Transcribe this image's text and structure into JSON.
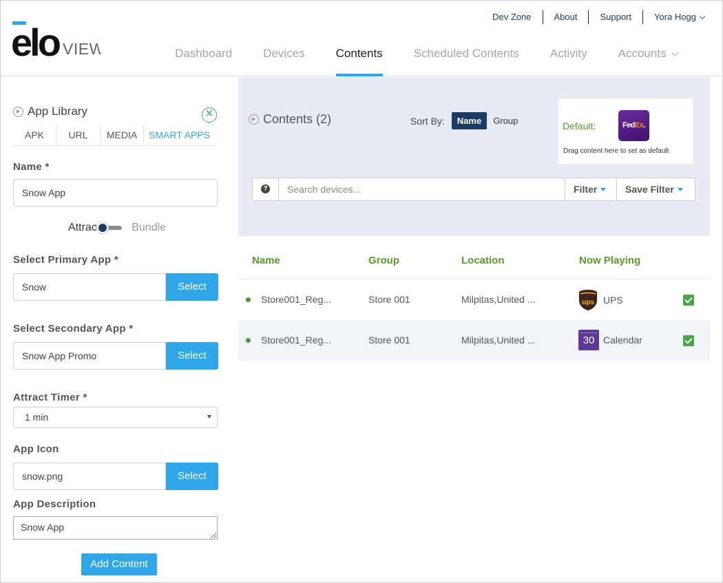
{
  "header": {
    "logo_text": "elo VIEW",
    "top_links": [
      "Dev Zone",
      "About",
      "Support",
      "Yora Hogg"
    ],
    "tabs": [
      {
        "label": "Dashboard",
        "active": false
      },
      {
        "label": "Devices",
        "active": false
      },
      {
        "label": "Contents",
        "active": true
      },
      {
        "label": "Scheduled Contents",
        "active": false
      },
      {
        "label": "Activity",
        "active": false
      },
      {
        "label": "Accounts",
        "active": false
      }
    ],
    "accent_color": "#2fa6e8"
  },
  "sidebar": {
    "title": "App Library",
    "lib_tabs": [
      {
        "label": "APK",
        "active": false
      },
      {
        "label": "URL",
        "active": false
      },
      {
        "label": "MEDIA",
        "active": false
      },
      {
        "label": "SMART APPS",
        "active": true
      }
    ],
    "name_label": "Name *",
    "name_value": "Snow App",
    "toggle_left": "Attract",
    "toggle_right": "Bundle",
    "primary_label": "Select Primary App *",
    "primary_value": "Snow",
    "secondary_label": "Select Secondary App *",
    "secondary_value": "Snow App Promo",
    "select_label": "Select",
    "timer_label": "Attract Timer *",
    "timer_value": "1 min",
    "icon_label": "App Icon",
    "icon_value": "snow.png",
    "desc_label": "App Description",
    "desc_value": "Snow App",
    "add_button": "Add Content"
  },
  "contents": {
    "title": "Contents (2)",
    "sort_label": "Sort By:",
    "sort_active": "Name",
    "sort_other": "Group",
    "default_label": "Default:",
    "default_app": "FedEx",
    "default_hint": "Drag content here to set as default",
    "search_placeholder": "Search devices...",
    "filter_label": "Filter",
    "save_filter_label": "Save Filter"
  },
  "table": {
    "headers": [
      "Name",
      "Group",
      "Location",
      "Now Playing"
    ],
    "rows": [
      {
        "name": "Store001_Reg...",
        "group": "Store 001",
        "location": "Milpitas,United ...",
        "now_playing": "UPS",
        "icon": "ups-icon",
        "checked": true
      },
      {
        "name": "Store001_Reg...",
        "group": "Store 001",
        "location": "Milpitas,United ...",
        "now_playing": "Calendar",
        "icon": "calendar-icon",
        "calendar_number": "30",
        "checked": true
      }
    ]
  }
}
